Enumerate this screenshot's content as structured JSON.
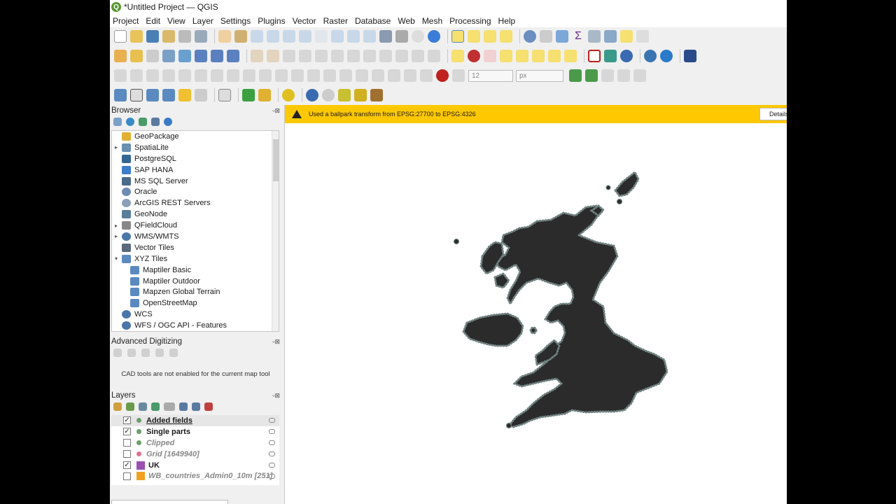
{
  "window": {
    "title": "*Untitled Project — QGIS"
  },
  "menu": [
    "Project",
    "Edit",
    "View",
    "Layer",
    "Settings",
    "Plugins",
    "Vector",
    "Raster",
    "Database",
    "Web",
    "Mesh",
    "Processing",
    "Help"
  ],
  "toolbar": {
    "size_value": "12",
    "size_unit": "px"
  },
  "browser": {
    "title": "Browser",
    "items": [
      {
        "label": "GeoPackage",
        "icon": "geopackage-icon",
        "arrow": "",
        "indent": 0,
        "color": "#e0b030"
      },
      {
        "label": "SpatiaLite",
        "icon": "spatialite-icon",
        "arrow": "▸",
        "indent": 0,
        "color": "#6a8fb0"
      },
      {
        "label": "PostgreSQL",
        "icon": "postgresql-icon",
        "arrow": "",
        "indent": 0,
        "color": "#336791"
      },
      {
        "label": "SAP HANA",
        "icon": "sap-hana-icon",
        "arrow": "",
        "indent": 0,
        "color": "#3d7cc9"
      },
      {
        "label": "MS SQL Server",
        "icon": "mssql-icon",
        "arrow": "",
        "indent": 0,
        "color": "#4a6a8a"
      },
      {
        "label": "Oracle",
        "icon": "oracle-icon",
        "arrow": "",
        "indent": 0,
        "color": "#6d8cb5"
      },
      {
        "label": "ArcGIS REST Servers",
        "icon": "arcgis-icon",
        "arrow": "",
        "indent": 0,
        "color": "#8aa0b8"
      },
      {
        "label": "GeoNode",
        "icon": "geonode-icon",
        "arrow": "",
        "indent": 0,
        "color": "#5a7d9a"
      },
      {
        "label": "QFieldCloud",
        "icon": "qfieldcloud-icon",
        "arrow": "▸",
        "indent": 0,
        "color": "#888"
      },
      {
        "label": "WMS/WMTS",
        "icon": "globe-icon",
        "arrow": "▸",
        "indent": 0,
        "color": "#4a76a8"
      },
      {
        "label": "Vector Tiles",
        "icon": "vector-tiles-icon",
        "arrow": "",
        "indent": 0,
        "color": "#5a6a7a"
      },
      {
        "label": "XYZ Tiles",
        "icon": "xyz-tiles-icon",
        "arrow": "▾",
        "indent": 0,
        "color": "#5a8ac0"
      },
      {
        "label": "Maptiler Basic",
        "icon": "tile-grid-icon",
        "arrow": "",
        "indent": 1,
        "color": "#5a8ac0"
      },
      {
        "label": "Maptiler Outdoor",
        "icon": "tile-grid-icon",
        "arrow": "",
        "indent": 1,
        "color": "#5a8ac0"
      },
      {
        "label": "Mapzen Global Terrain",
        "icon": "tile-grid-icon",
        "arrow": "",
        "indent": 1,
        "color": "#5a8ac0"
      },
      {
        "label": "OpenStreetMap",
        "icon": "tile-grid-icon",
        "arrow": "",
        "indent": 1,
        "color": "#5a8ac0"
      },
      {
        "label": "WCS",
        "icon": "globe-icon",
        "arrow": "",
        "indent": 0,
        "color": "#4a76a8"
      },
      {
        "label": "WFS / OGC API - Features",
        "icon": "globe-icon",
        "arrow": "",
        "indent": 0,
        "color": "#4a76a8"
      }
    ]
  },
  "advanced": {
    "title": "Advanced Digitizing",
    "message": "CAD tools are not enabled for the current map tool"
  },
  "layers": {
    "title": "Layers",
    "items": [
      {
        "name": "Added fields",
        "checked": "✓",
        "symbol": "#6b9e6b",
        "shape": "circle",
        "style": "bold ul"
      },
      {
        "name": "Single parts",
        "checked": "✓",
        "symbol": "#6b9e6b",
        "shape": "circle",
        "style": "bold"
      },
      {
        "name": "Clipped",
        "checked": "",
        "symbol": "#6b9e6b",
        "shape": "circle",
        "style": "ital"
      },
      {
        "name": "Grid [1649940]",
        "checked": "",
        "symbol": "#e07090",
        "shape": "circle",
        "style": "ital"
      },
      {
        "name": "UK",
        "checked": "✓",
        "symbol": "#9b4fb0",
        "shape": "sq",
        "style": "bold"
      },
      {
        "name": "WB_countries_Admin0_10m [251]",
        "checked": "",
        "symbol": "#f0a020",
        "shape": "sq",
        "style": "ital"
      }
    ]
  },
  "message_bar": {
    "text": "Used a ballpark transform from EPSG:27700 to EPSG:4326",
    "button": "Details"
  },
  "colors": {
    "map_fill": "#2b2b2b",
    "coast_points": "#7a8c8a",
    "message_bar": "#ffc800"
  }
}
